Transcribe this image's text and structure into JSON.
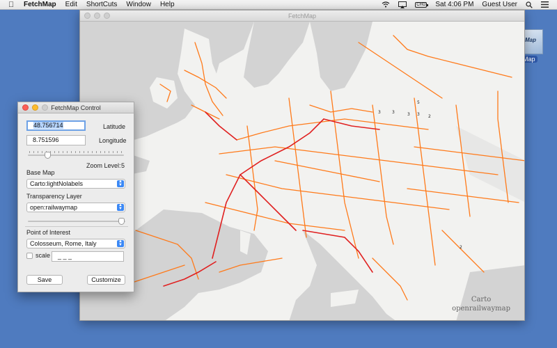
{
  "menubar": {
    "app_name": "FetchMap",
    "menus": [
      "Edit",
      "ShortCuts",
      "Window",
      "Help"
    ],
    "battery_label": "CHG",
    "clock": "Sat 4:06 PM",
    "user": "Guest User"
  },
  "desktop": {
    "icon_label": "Map",
    "icon_caption": "Map"
  },
  "map_window": {
    "title": "FetchMap",
    "attribution_line1": "Carto",
    "attribution_line2": "openrailwaymap"
  },
  "control": {
    "title": "FetchMap Control",
    "latitude_value": "48.756714",
    "latitude_label": "Latitude",
    "longitude_value": "8.751596",
    "longitude_label": "Longitude",
    "zoom_label": "Zoom Level:",
    "zoom_value": "5",
    "base_map_label": "Base Map",
    "base_map_selected": "Carto:lightNolabels",
    "transparency_label": "Transparency Layer",
    "transparency_selected": "open:railwaymap",
    "poi_label": "Point of Interest",
    "poi_selected": "Colosseum, Rome, Italy",
    "scale_label": "scale",
    "scale_value": "_ _ _",
    "save_label": "Save",
    "customize_label": "Customize"
  },
  "colors": {
    "desktop": "#4f7bbf",
    "rail_main": "#ff7a1a",
    "rail_high": "#e02020",
    "land": "#f2f2f0",
    "sea": "#d3d3d3",
    "accent": "#3b88f5"
  }
}
